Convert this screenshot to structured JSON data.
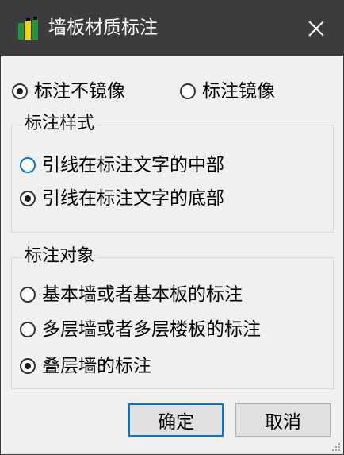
{
  "window": {
    "title": "墙板材质标注",
    "icons": {
      "app": "app-icon",
      "close": "close-icon",
      "resize": "resize-grip-icon"
    },
    "colors": {
      "titlebar": "#3c3c3c",
      "accent": "#0078d7",
      "background": "#f0f0f0"
    }
  },
  "mirror_options": [
    {
      "label": "标注不镜像",
      "checked": true
    },
    {
      "label": "标注镜像",
      "checked": false
    }
  ],
  "style_group": {
    "title": "标注样式",
    "options": [
      {
        "label": "引线在标注文字的中部",
        "checked": false,
        "focused": true
      },
      {
        "label": "引线在标注文字的底部",
        "checked": true,
        "focused": false
      }
    ]
  },
  "object_group": {
    "title": "标注对象",
    "options": [
      {
        "label": "基本墙或者基本板的标注",
        "checked": false
      },
      {
        "label": "多层墙或者多层楼板的标注",
        "checked": false
      },
      {
        "label": "叠层墙的标注",
        "checked": true
      }
    ]
  },
  "buttons": {
    "ok": "确定",
    "cancel": "取消"
  }
}
